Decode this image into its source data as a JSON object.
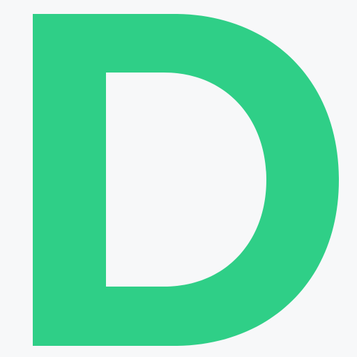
{
  "logo": {
    "letter": "D",
    "icon": "letter-d-logo-icon",
    "colors": {
      "letter": "#2fcf87",
      "background": "#f7f8f9"
    }
  }
}
